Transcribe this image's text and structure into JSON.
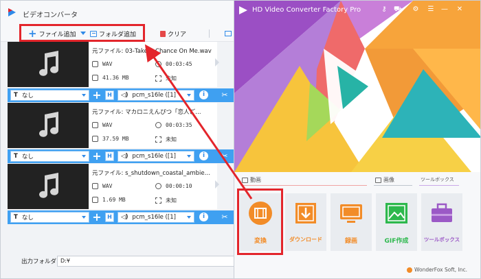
{
  "left_window": {
    "title": "ビデオコンバータ",
    "toolbar": {
      "add_file": "ファイル追加",
      "add_folder": "フォルダ追加",
      "clear": "クリア"
    },
    "files": [
      {
        "source_name": "元ファイル: 03-Take A Chance On Me.wav",
        "format": "WAV",
        "duration": "00:03:45",
        "size": "41.36 MB",
        "resolution": "未知",
        "subtitle": "なし",
        "audio_track": "pcm_s16le ([1]"
      },
      {
        "source_name": "元ファイル: マカロニえんぴつ「恋人ご…",
        "format": "WAV",
        "duration": "00:03:35",
        "size": "37.59 MB",
        "resolution": "未知",
        "subtitle": "なし",
        "audio_track": "pcm_s16le ([1]"
      },
      {
        "source_name": "元ファイル: s_shutdown_coastal_ambie…",
        "format": "WAV",
        "duration": "00:00:10",
        "size": "1.69 MB",
        "resolution": "未知",
        "subtitle": "なし",
        "audio_track": "pcm_s16le ([1]"
      }
    ],
    "output": {
      "label": "出力フォルダ:",
      "path": "D:¥"
    }
  },
  "right_window": {
    "title": "HD Video Converter Factory Pro",
    "sections": {
      "video": "動画",
      "image": "画像",
      "toolbox": "ツールボックス"
    },
    "tiles": [
      {
        "label": "変換",
        "color": "#f28c28"
      },
      {
        "label": "ダウンロード",
        "color": "#f28c28"
      },
      {
        "label": "録画",
        "color": "#f28c28"
      },
      {
        "label": "GIF作成",
        "color": "#2db84d"
      },
      {
        "label": "ツールボックス",
        "color": "#9b59c6"
      }
    ],
    "footer": "WonderFox Soft, Inc."
  },
  "colors": {
    "accent_blue": "#3fa0f1",
    "highlight_red": "#e3252b"
  }
}
